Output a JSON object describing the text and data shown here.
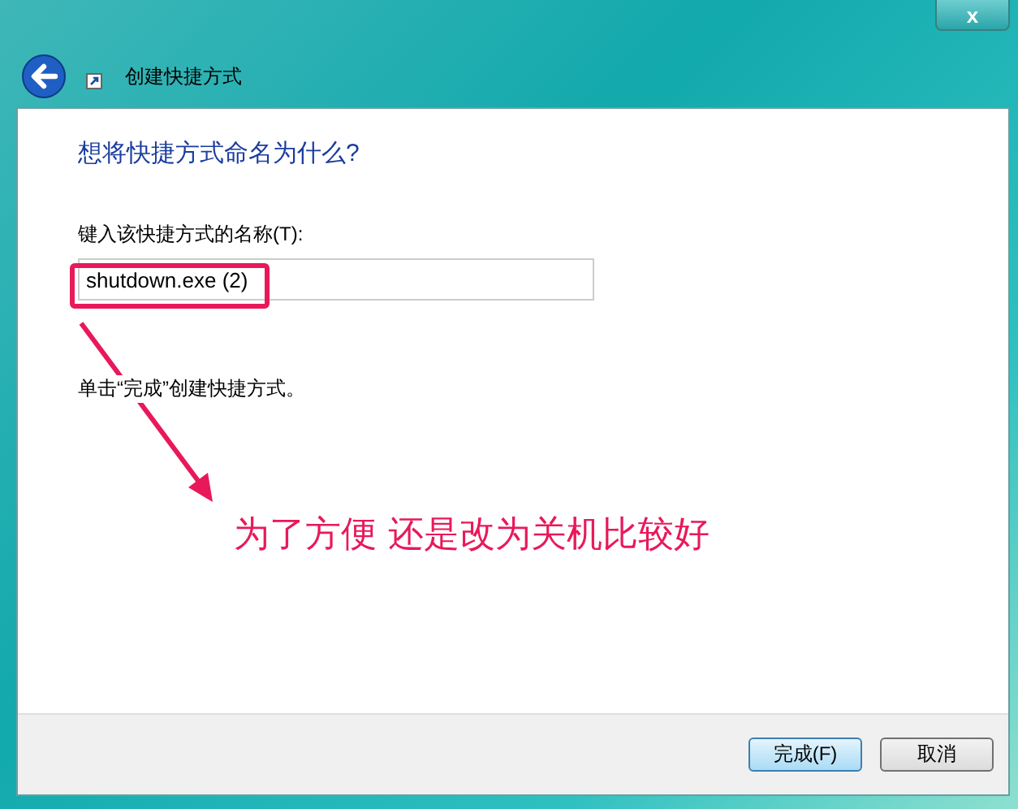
{
  "window": {
    "title": "创建快捷方式",
    "close": "x"
  },
  "heading": "想将快捷方式命名为什么?",
  "name_field": {
    "label": "键入该快捷方式的名称(T):",
    "value": "shutdown.exe (2)"
  },
  "hint": "单击“完成”创建快捷方式。",
  "annotation": {
    "text": "为了方便  还是改为关机比较好"
  },
  "buttons": [
    {
      "label": "完成(F)",
      "default": true
    },
    {
      "label": "取消",
      "default": false
    }
  ]
}
